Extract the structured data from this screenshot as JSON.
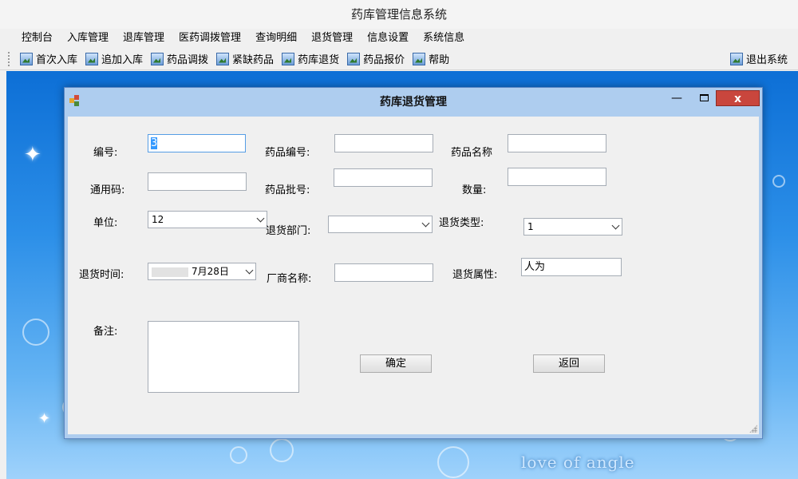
{
  "app": {
    "title": "药库管理信息系统"
  },
  "menu": [
    "控制台",
    "入库管理",
    "退库管理",
    "医药调拨管理",
    "查询明细",
    "退货管理",
    "信息设置",
    "系统信息"
  ],
  "toolbar": {
    "items": [
      "首次入库",
      "追加入库",
      "药品调拨",
      "紧缺药品",
      "药库退货",
      "药品报价",
      "帮助"
    ],
    "exit": "退出系统"
  },
  "desktop": {
    "watermark": "love of angle"
  },
  "dialog": {
    "title": "药库退货管理",
    "close_label": "x",
    "labels": {
      "id": "编号:",
      "drug_code": "药品编号:",
      "drug_name": "药品名称",
      "generic_code": "通用码:",
      "batch_no": "药品批号:",
      "quantity": "数量:",
      "unit": "单位:",
      "dept": "退货部门:",
      "return_type": "退货类型:",
      "return_time": "退货时间:",
      "manufacturer": "厂商名称:",
      "attribute": "退货属性:",
      "remark": "备注:"
    },
    "fields": {
      "id": "3",
      "drug_code": "",
      "drug_name": "",
      "generic_code": "",
      "batch_no": "",
      "quantity": "",
      "unit": "12",
      "dept": "",
      "return_type": "1",
      "return_time": "7月28日",
      "manufacturer": "",
      "attribute": "人为",
      "remark": ""
    },
    "buttons": {
      "ok": "确定",
      "back": "返回"
    }
  }
}
